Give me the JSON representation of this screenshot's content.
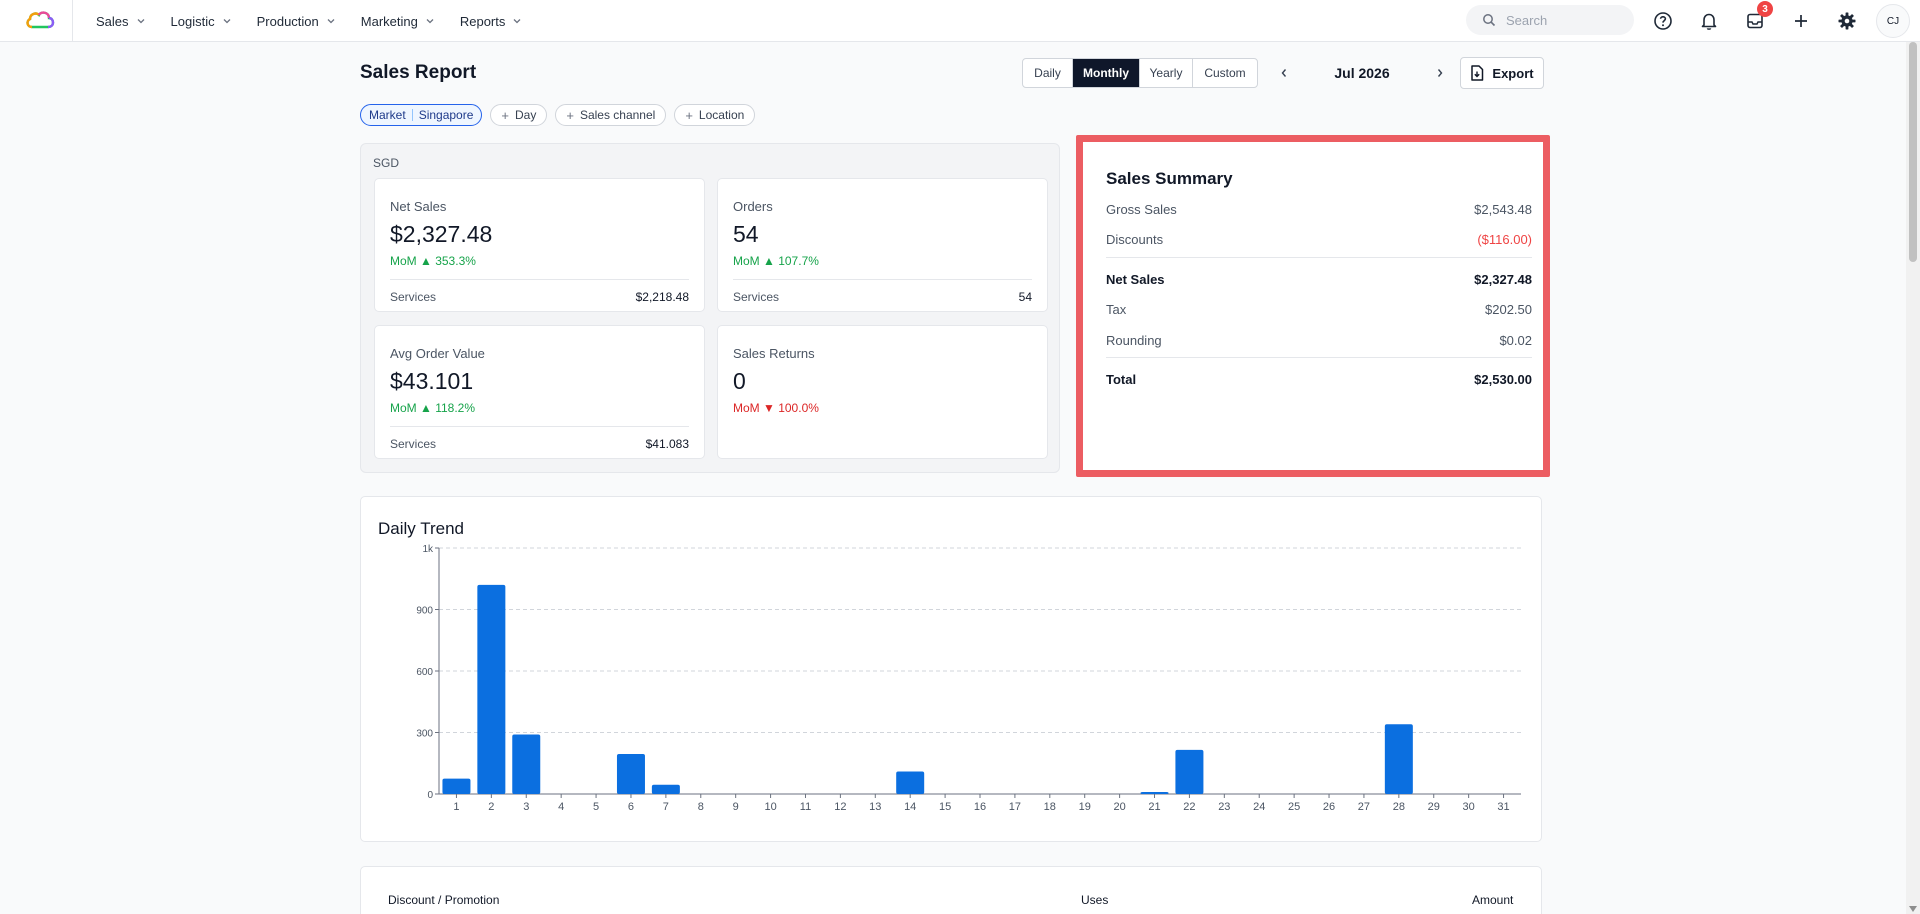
{
  "nav": {
    "items": [
      {
        "label": "Sales"
      },
      {
        "label": "Logistic"
      },
      {
        "label": "Production"
      },
      {
        "label": "Marketing"
      },
      {
        "label": "Reports"
      }
    ],
    "search_placeholder": "Search",
    "inbox_badge": "3",
    "avatar_initials": "CJ"
  },
  "header": {
    "title": "Sales Report",
    "periods": [
      "Daily",
      "Monthly",
      "Yearly",
      "Custom"
    ],
    "active_period": "Monthly",
    "current_period": "Jul 2026",
    "export_label": "Export"
  },
  "filters": {
    "market_label": "Market",
    "market_value": "Singapore",
    "add_filters": [
      "Day",
      "Sales channel",
      "Location"
    ]
  },
  "kpis": {
    "currency": "SGD",
    "cards": [
      {
        "label": "Net Sales",
        "value": "$2,327.48",
        "change": "MoM ▲ 353.3%",
        "direction": "up",
        "foot_label": "Services",
        "foot_value": "$2,218.48"
      },
      {
        "label": "Orders",
        "value": "54",
        "change": "MoM ▲ 107.7%",
        "direction": "up",
        "foot_label": "Services",
        "foot_value": "54"
      },
      {
        "label": "Avg Order Value",
        "value": "$43.101",
        "change": "MoM ▲ 118.2%",
        "direction": "up",
        "foot_label": "Services",
        "foot_value": "$41.083"
      },
      {
        "label": "Sales Returns",
        "value": "0",
        "change": "MoM ▼ 100.0%",
        "direction": "down",
        "foot_label": "",
        "foot_value": ""
      }
    ]
  },
  "summary": {
    "title": "Sales Summary",
    "gross_sales_label": "Gross Sales",
    "gross_sales": "$2,543.48",
    "discounts_label": "Discounts",
    "discounts": "($116.00)",
    "net_sales_label": "Net Sales",
    "net_sales": "$2,327.48",
    "tax_label": "Tax",
    "tax": "$202.50",
    "rounding_label": "Rounding",
    "rounding": "$0.02",
    "total_label": "Total",
    "total": "$2,530.00",
    "highlight_color": "#ec5d62"
  },
  "trend": {
    "title": "Daily Trend"
  },
  "chart_data": {
    "type": "bar",
    "title": "Daily Trend",
    "categories": [
      "1",
      "2",
      "3",
      "4",
      "5",
      "6",
      "7",
      "8",
      "9",
      "10",
      "11",
      "12",
      "13",
      "14",
      "15",
      "16",
      "17",
      "18",
      "19",
      "20",
      "21",
      "22",
      "23",
      "24",
      "25",
      "26",
      "27",
      "28",
      "29",
      "30",
      "31"
    ],
    "values": [
      75,
      1020,
      290,
      0,
      0,
      195,
      45,
      0,
      0,
      0,
      0,
      0,
      0,
      110,
      0,
      0,
      0,
      0,
      0,
      0,
      10,
      215,
      0,
      0,
      0,
      0,
      0,
      340,
      0,
      0,
      0
    ],
    "ylim": [
      0,
      1200
    ],
    "yticks": [
      0,
      300,
      600,
      900,
      1200
    ],
    "ytick_labels": [
      "0",
      "300",
      "600",
      "900",
      "1k"
    ],
    "grid": true,
    "bar_color": "#0b6fe0"
  },
  "discounts_table": {
    "col_name": "Discount / Promotion",
    "col_uses": "Uses",
    "col_amount": "Amount"
  }
}
